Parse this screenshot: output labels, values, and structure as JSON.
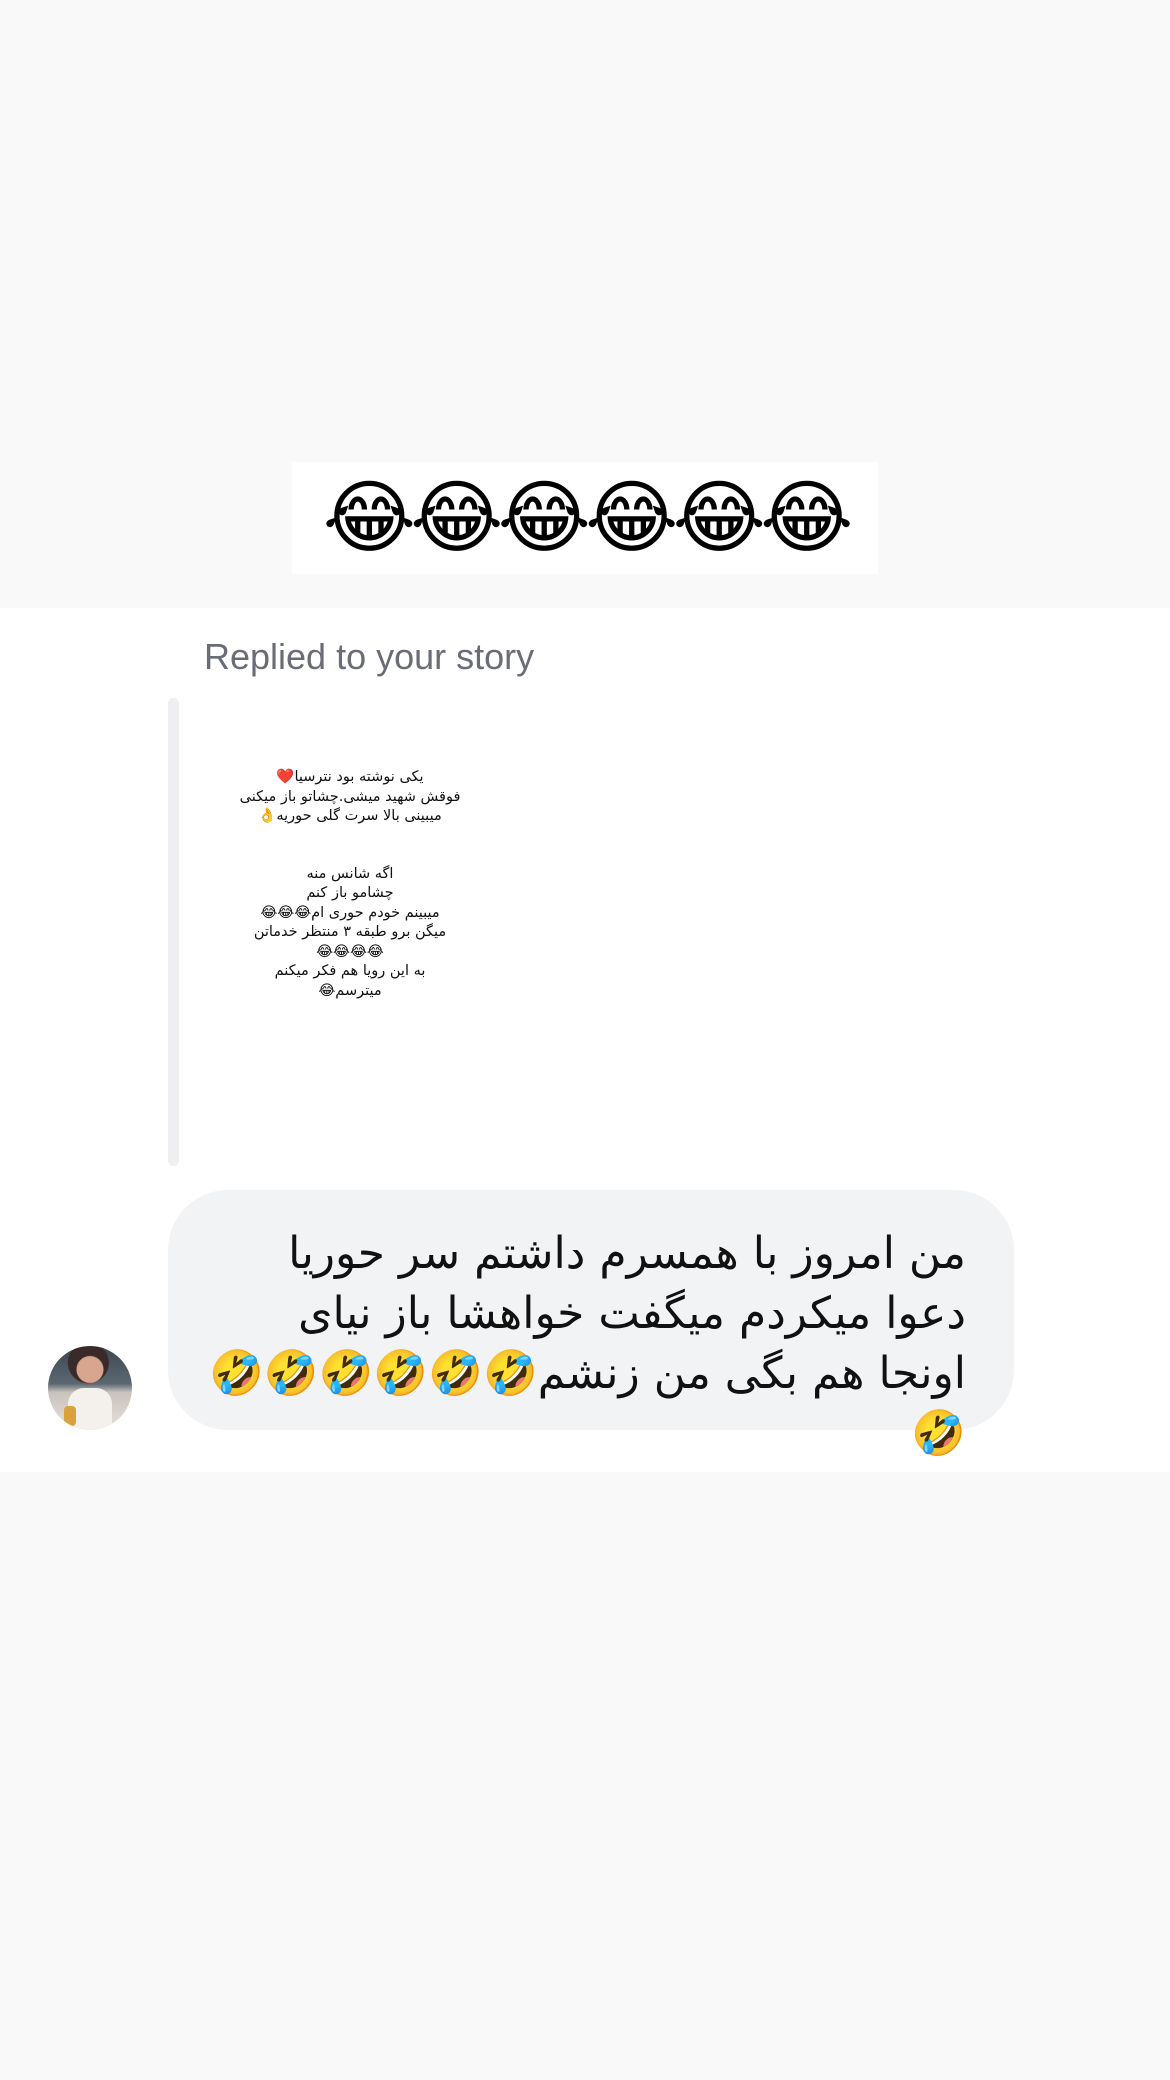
{
  "header": {
    "story_emojis": "😂😂😂😂😂😂"
  },
  "thread": {
    "replied_label": "Replied to your story",
    "story_lines": [
      "یکی نوشته بود نترسیا❤️",
      "فوقش شهید میشی.چشاتو باز میکنی",
      "میبینی بالا سرت گلی حوریه👌",
      "اگه شانس منه",
      "چشامو باز کنم",
      "میبینم خودم حوری ام😂😂😂",
      "میگن برو طبقه ۳ منتظر خدماتن",
      "😂😂😂😂",
      "به این رویا هم فکر میکنم",
      "میترسم😂"
    ],
    "message_text": "من امروز با همسرم داشتم سر حوریا دعوا میکردم میگفت خواهشا باز نیای اونجا هم بگی من زنشم🤣🤣🤣🤣🤣🤣🤣"
  }
}
